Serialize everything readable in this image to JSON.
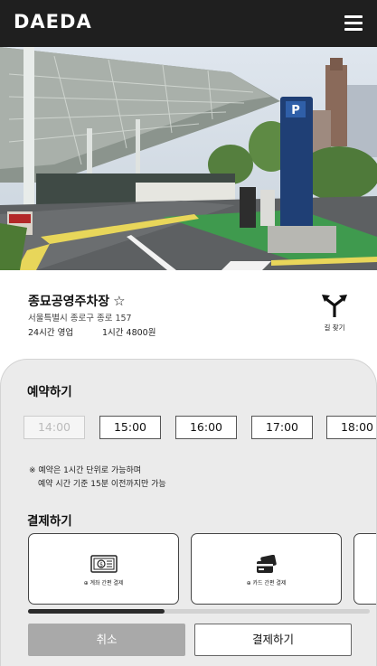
{
  "header": {
    "logo": "DAEDA",
    "menu_icon": "hamburger-menu-icon"
  },
  "hero": {
    "description_icon": "parking-lot-photo"
  },
  "place": {
    "name": "종묘공영주차장",
    "favorite_icon": "☆",
    "address": "서울특별시 종로구 종로 157",
    "hours": "24시간 영업",
    "price": "1시간 4800원",
    "directions_label": "길 찾기",
    "directions_icon": "directions-icon"
  },
  "reservation": {
    "title": "예약하기",
    "time_slots": [
      {
        "label": "14:00",
        "enabled": false
      },
      {
        "label": "15:00",
        "enabled": true
      },
      {
        "label": "16:00",
        "enabled": true
      },
      {
        "label": "17:00",
        "enabled": true
      },
      {
        "label": "18:00",
        "enabled": true
      }
    ],
    "notice_line1": "※ 예약은 1시간 단위로 가능하며",
    "notice_line2": "예약 시간 기준 15분 이전까지만 가능"
  },
  "payment": {
    "title": "결제하기",
    "methods": [
      {
        "label": "계좌 간편 결제",
        "icon": "bank-account-icon"
      },
      {
        "label": "카드 간편 결제",
        "icon": "credit-card-icon"
      }
    ],
    "scroll_progress": 0.4
  },
  "actions": {
    "cancel_label": "취소",
    "pay_label": "결제하기"
  },
  "colors": {
    "header_bg": "#1f1f1f",
    "sheet_bg": "#ebebeb",
    "cancel_bg": "#a9a9a9"
  }
}
